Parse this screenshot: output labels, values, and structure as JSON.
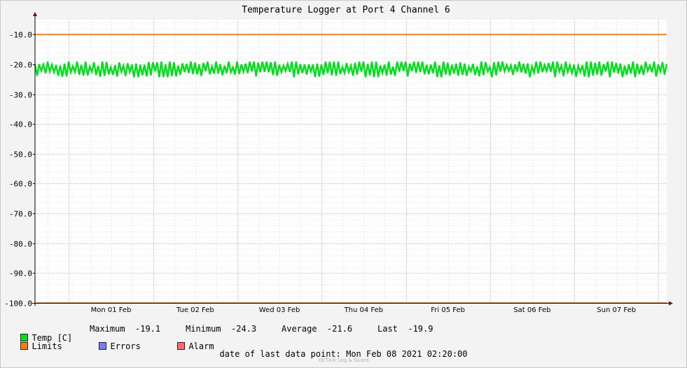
{
  "chart_data": {
    "type": "line",
    "title": "Temperature Logger at Port 4 Channel 6",
    "ylim": [
      -100,
      -5
    ],
    "y_ticks": [
      -10,
      -20,
      -30,
      -40,
      -50,
      -60,
      -70,
      -80,
      -90,
      -100
    ],
    "y_tick_labels": [
      "-10.0",
      "-20.0",
      "-30.0",
      "-40.0",
      "-50.0",
      "-60.0",
      "-70.0",
      "-80.0",
      "-90.0",
      "-100.0"
    ],
    "x_tick_labels": [
      "Mon 01 Feb",
      "Tue 02 Feb",
      "Wed 03 Feb",
      "Thu 04 Feb",
      "Fri 05 Feb",
      "Sat 06 Feb",
      "Sun 07 Feb"
    ],
    "x_range": [
      "2021-01-31 14:20",
      "2021-02-08 02:20"
    ],
    "grid": true,
    "series": [
      {
        "name": "Temp [C]",
        "color": "#00e01a",
        "kind": "noisy",
        "min": -24.3,
        "max": -19.1,
        "average": -21.6,
        "last": -19.9
      },
      {
        "name": "Limits",
        "color": "#ff7f00",
        "kind": "constant",
        "values": [
          -10.0,
          -100.0
        ]
      },
      {
        "name": "Errors",
        "color": "#7b7bff",
        "kind": "none"
      },
      {
        "name": "Alarm",
        "color": "#ff6b6b",
        "kind": "none"
      }
    ]
  },
  "legend": {
    "temp_label": "Temp [C]",
    "maximum_label": "Maximum",
    "maximum_value": "-19.1",
    "minimum_label": "Minimum",
    "minimum_value": "-24.3",
    "average_label": "Average",
    "average_value": "-21.6",
    "last_label": "Last",
    "last_value": "-19.9",
    "limits_label": "Limits",
    "errors_label": "Errors",
    "alarm_label": "Alarm"
  },
  "footer": {
    "last_point_label": "date of last data point:",
    "last_point_value": "Mon Feb 08 2021 02:20:00",
    "watermark": "OCTA® Log & Guard"
  },
  "colors": {
    "background": "#f3f3f3",
    "plot_area": "#ffffff",
    "temp": "#00e01a",
    "limits": "#ff7f00",
    "errors": "#7b7bff",
    "alarm": "#ff6b6b",
    "grid_major": "#e8a0a0",
    "grid_minor": "#cccccc"
  }
}
